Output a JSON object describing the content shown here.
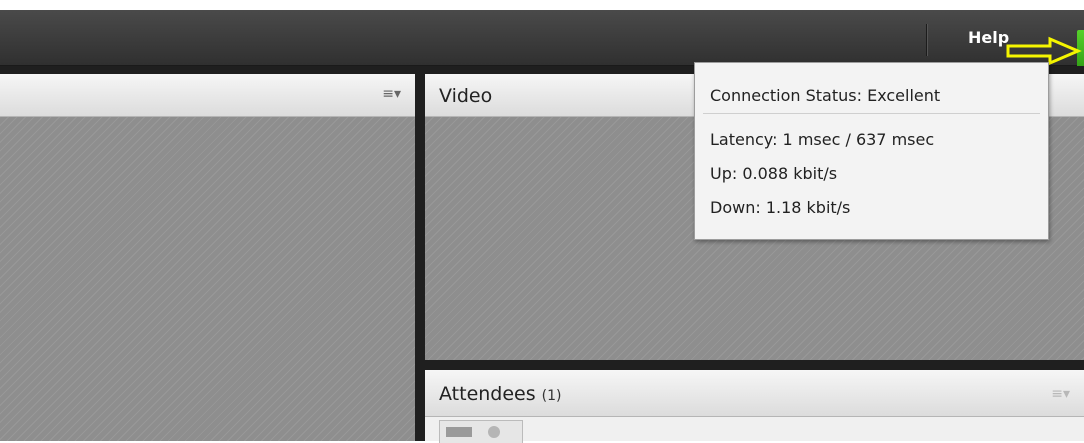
{
  "topbar": {
    "help_label": "Help"
  },
  "pods": {
    "left_menu_icon": "≡▾",
    "video": {
      "title": "Video"
    },
    "attendees": {
      "title": "Attendees",
      "count": "(1)",
      "menu_icon": "≡▾"
    }
  },
  "connection_popup": {
    "status": "Connection Status:  Excellent",
    "latency": "Latency:  1 msec / 637 msec",
    "up": "Up:  0.088 kbit/s",
    "down": "Down:  1.18 kbit/s"
  },
  "colors": {
    "connection_good": "#3bb81b",
    "annotation_arrow": "#f5f500"
  },
  "icons": [
    "pod-options-icon",
    "connection-status-icon",
    "annotation-arrow-icon",
    "list-view-icon",
    "person-icon"
  ]
}
